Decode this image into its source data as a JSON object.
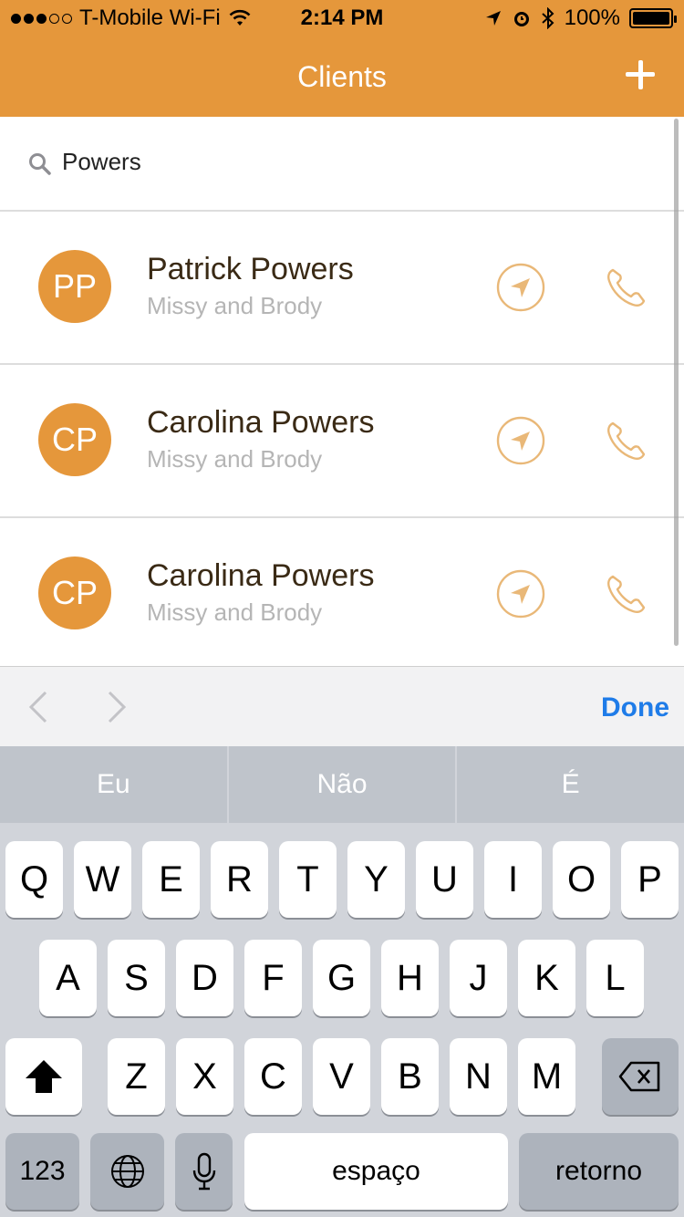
{
  "status_bar": {
    "carrier": "T-Mobile Wi-Fi",
    "time": "2:14 PM",
    "battery": "100%",
    "icons": [
      "signal-dots-icon",
      "wifi-icon",
      "location-arrow-icon",
      "alarm-icon",
      "bluetooth-icon",
      "battery-icon"
    ]
  },
  "nav": {
    "title": "Clients",
    "add_icon": "plus-icon"
  },
  "search": {
    "value": "Powers",
    "icon": "search-icon"
  },
  "clients": [
    {
      "initials": "PP",
      "name": "Patrick Powers",
      "subtitle": "Missy and Brody"
    },
    {
      "initials": "CP",
      "name": "Carolina Powers",
      "subtitle": "Missy and Brody"
    },
    {
      "initials": "CP",
      "name": "Carolina Powers",
      "subtitle": "Missy and Brody"
    }
  ],
  "accessory": {
    "done_label": "Done"
  },
  "keyboard": {
    "predictions": [
      "Eu",
      "Não",
      "É"
    ],
    "row1": [
      "Q",
      "W",
      "E",
      "R",
      "T",
      "Y",
      "U",
      "I",
      "O",
      "P"
    ],
    "row2": [
      "A",
      "S",
      "D",
      "F",
      "G",
      "H",
      "J",
      "K",
      "L"
    ],
    "row3": [
      "Z",
      "X",
      "C",
      "V",
      "B",
      "N",
      "M"
    ],
    "numbers_label": "123",
    "space_label": "espaço",
    "return_label": "retorno"
  },
  "colors": {
    "accent": "#E5973B",
    "done": "#1F7CE8"
  }
}
